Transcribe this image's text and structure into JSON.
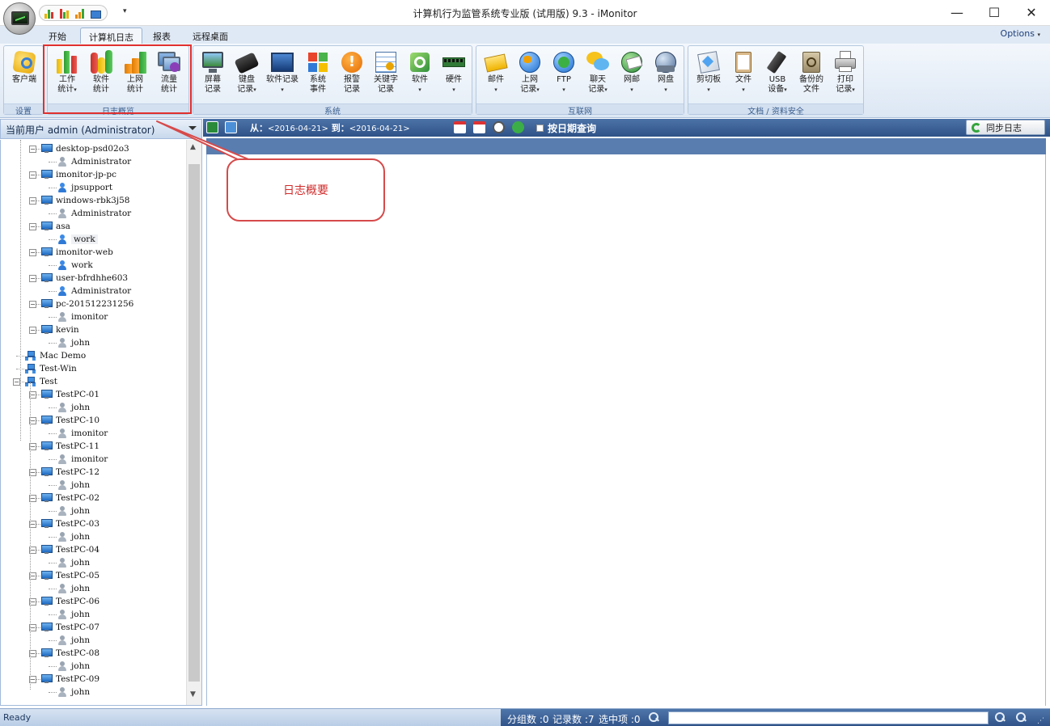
{
  "window": {
    "title": "计算机行为监管系统专业版 (试用版) 9.3 - iMonitor",
    "minimize": "—",
    "maximize": "☐",
    "close": "✕"
  },
  "ribbon": {
    "tabs": [
      {
        "label": "开始"
      },
      {
        "label": "计算机日志",
        "active": true
      },
      {
        "label": "报表"
      },
      {
        "label": "远程桌面"
      }
    ],
    "options_label": "Options",
    "groups": {
      "settings": {
        "label": "设置",
        "buttons": [
          {
            "line1": "客户端",
            "line2": ""
          }
        ]
      },
      "overview": {
        "label": "日志概览",
        "buttons": [
          {
            "line1": "工作",
            "line2": "统计"
          },
          {
            "line1": "软件",
            "line2": "统计"
          },
          {
            "line1": "上网",
            "line2": "统计"
          },
          {
            "line1": "流量",
            "line2": "统计"
          }
        ]
      },
      "system": {
        "label": "系统",
        "buttons": [
          {
            "line1": "屏幕",
            "line2": "记录"
          },
          {
            "line1": "键盘",
            "line2": "记录"
          },
          {
            "line1": "软件记录",
            "line2": ""
          },
          {
            "line1": "系统",
            "line2": "事件"
          },
          {
            "line1": "报警",
            "line2": "记录"
          },
          {
            "line1": "关键字",
            "line2": "记录"
          },
          {
            "line1": "软件",
            "line2": ""
          },
          {
            "line1": "硬件",
            "line2": ""
          }
        ]
      },
      "internet": {
        "label": "互联网",
        "buttons": [
          {
            "line1": "邮件",
            "line2": ""
          },
          {
            "line1": "上网",
            "line2": "记录"
          },
          {
            "line1": "FTP",
            "line2": ""
          },
          {
            "line1": "聊天",
            "line2": "记录"
          },
          {
            "line1": "网邮",
            "line2": ""
          },
          {
            "line1": "网盘",
            "line2": ""
          }
        ]
      },
      "docs": {
        "label": "文档 / 资料安全",
        "buttons": [
          {
            "line1": "剪切板",
            "line2": ""
          },
          {
            "line1": "文件",
            "line2": ""
          },
          {
            "line1": "USB",
            "line2": "设备"
          },
          {
            "line1": "备份的",
            "line2": "文件"
          },
          {
            "line1": "打印",
            "line2": "记录"
          }
        ]
      }
    }
  },
  "sidebar": {
    "current_user": "当前用户  admin (Administrator)",
    "tree": [
      {
        "type": "pc",
        "label": "desktop-psd02o3",
        "level": 1
      },
      {
        "type": "user",
        "label": "Administrator",
        "level": 2
      },
      {
        "type": "pc",
        "label": "imonitor-jp-pc",
        "level": 1
      },
      {
        "type": "user",
        "label": "jpsupport",
        "level": 2,
        "active": true
      },
      {
        "type": "pc",
        "label": "windows-rbk3j58",
        "level": 1
      },
      {
        "type": "user",
        "label": "Administrator",
        "level": 2
      },
      {
        "type": "pc",
        "label": "asa",
        "level": 1
      },
      {
        "type": "user",
        "label": "work",
        "level": 2,
        "active": true,
        "selected": true
      },
      {
        "type": "pc",
        "label": "imonitor-web",
        "level": 1
      },
      {
        "type": "user",
        "label": "work",
        "level": 2,
        "active": true
      },
      {
        "type": "pc",
        "label": "user-bfrdhhe603",
        "level": 1
      },
      {
        "type": "user",
        "label": "Administrator",
        "level": 2,
        "active": true
      },
      {
        "type": "pc",
        "label": "pc-201512231256",
        "level": 1
      },
      {
        "type": "user",
        "label": "imonitor",
        "level": 2
      },
      {
        "type": "pc",
        "label": "kevin",
        "level": 1
      },
      {
        "type": "user",
        "label": "john",
        "level": 2
      },
      {
        "type": "group",
        "label": "Mac Demo",
        "level": 0
      },
      {
        "type": "group",
        "label": "Test-Win",
        "level": 0
      },
      {
        "type": "group",
        "label": "Test",
        "level": 0,
        "expanded": true
      },
      {
        "type": "pc",
        "label": "TestPC-01",
        "level": 1
      },
      {
        "type": "user",
        "label": "john",
        "level": 2
      },
      {
        "type": "pc",
        "label": "TestPC-10",
        "level": 1
      },
      {
        "type": "user",
        "label": "imonitor",
        "level": 2
      },
      {
        "type": "pc",
        "label": "TestPC-11",
        "level": 1
      },
      {
        "type": "user",
        "label": "imonitor",
        "level": 2
      },
      {
        "type": "pc",
        "label": "TestPC-12",
        "level": 1
      },
      {
        "type": "user",
        "label": "john",
        "level": 2
      },
      {
        "type": "pc",
        "label": "TestPC-02",
        "level": 1
      },
      {
        "type": "user",
        "label": "john",
        "level": 2
      },
      {
        "type": "pc",
        "label": "TestPC-03",
        "level": 1
      },
      {
        "type": "user",
        "label": "john",
        "level": 2
      },
      {
        "type": "pc",
        "label": "TestPC-04",
        "level": 1
      },
      {
        "type": "user",
        "label": "john",
        "level": 2
      },
      {
        "type": "pc",
        "label": "TestPC-05",
        "level": 1
      },
      {
        "type": "user",
        "label": "john",
        "level": 2
      },
      {
        "type": "pc",
        "label": "TestPC-06",
        "level": 1
      },
      {
        "type": "user",
        "label": "john",
        "level": 2
      },
      {
        "type": "pc",
        "label": "TestPC-07",
        "level": 1
      },
      {
        "type": "user",
        "label": "john",
        "level": 2
      },
      {
        "type": "pc",
        "label": "TestPC-08",
        "level": 1
      },
      {
        "type": "user",
        "label": "john",
        "level": 2
      },
      {
        "type": "pc",
        "label": "TestPC-09",
        "level": 1
      },
      {
        "type": "user",
        "label": "john",
        "level": 2
      }
    ]
  },
  "toolbar": {
    "from_label": "从：",
    "from_date": "<2016-04-21>",
    "to_label": " 到：",
    "to_date": "<2016-04-21>",
    "date_query": "按日期查询",
    "sync_label": "同步日志"
  },
  "callout": {
    "text": "日志概要"
  },
  "status": {
    "ready": "Ready",
    "groups": "分组数 :0",
    "records": "记录数 :7",
    "selected": "选中项 :0"
  },
  "colors": {
    "accent": "#2f5288",
    "callout": "#d12b2b",
    "highlight": "#e0302f"
  }
}
